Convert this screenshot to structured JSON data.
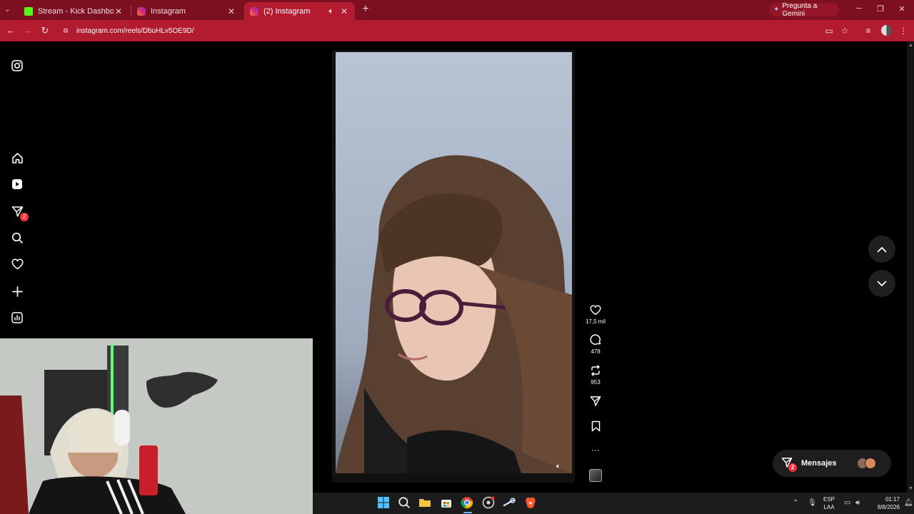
{
  "browser": {
    "tabs": [
      {
        "title": "Stream - Kick Dashboard",
        "favicon": "kick-icon",
        "active": false
      },
      {
        "title": "Instagram",
        "favicon": "instagram-icon",
        "active": false
      },
      {
        "title": "(2) Instagram",
        "favicon": "instagram-icon",
        "active": true
      }
    ],
    "gemini_label": "Pregunta a Gemini",
    "url": "instagram.com/reels/DbuHLv5OE9D/",
    "colors": {
      "tabbar": "#7c1020",
      "toolbar": "#b31b31"
    }
  },
  "sidebar": {
    "items": [
      {
        "name": "instagram-logo-icon"
      },
      {
        "name": "home-icon"
      },
      {
        "name": "reels-icon"
      },
      {
        "name": "direct-messages-icon",
        "badge": "2"
      },
      {
        "name": "search-icon"
      },
      {
        "name": "notifications-heart-icon"
      },
      {
        "name": "create-plus-icon"
      },
      {
        "name": "dashboard-icon"
      }
    ]
  },
  "reel": {
    "actions": {
      "likes": "17,5 mil",
      "comments": "478",
      "reposts": "953"
    }
  },
  "messages": {
    "label": "Mensajes",
    "badge": "2"
  },
  "taskbar": {
    "language": "ESP",
    "layout": "LAA",
    "time": "01:17",
    "date": "8/8/2026"
  }
}
